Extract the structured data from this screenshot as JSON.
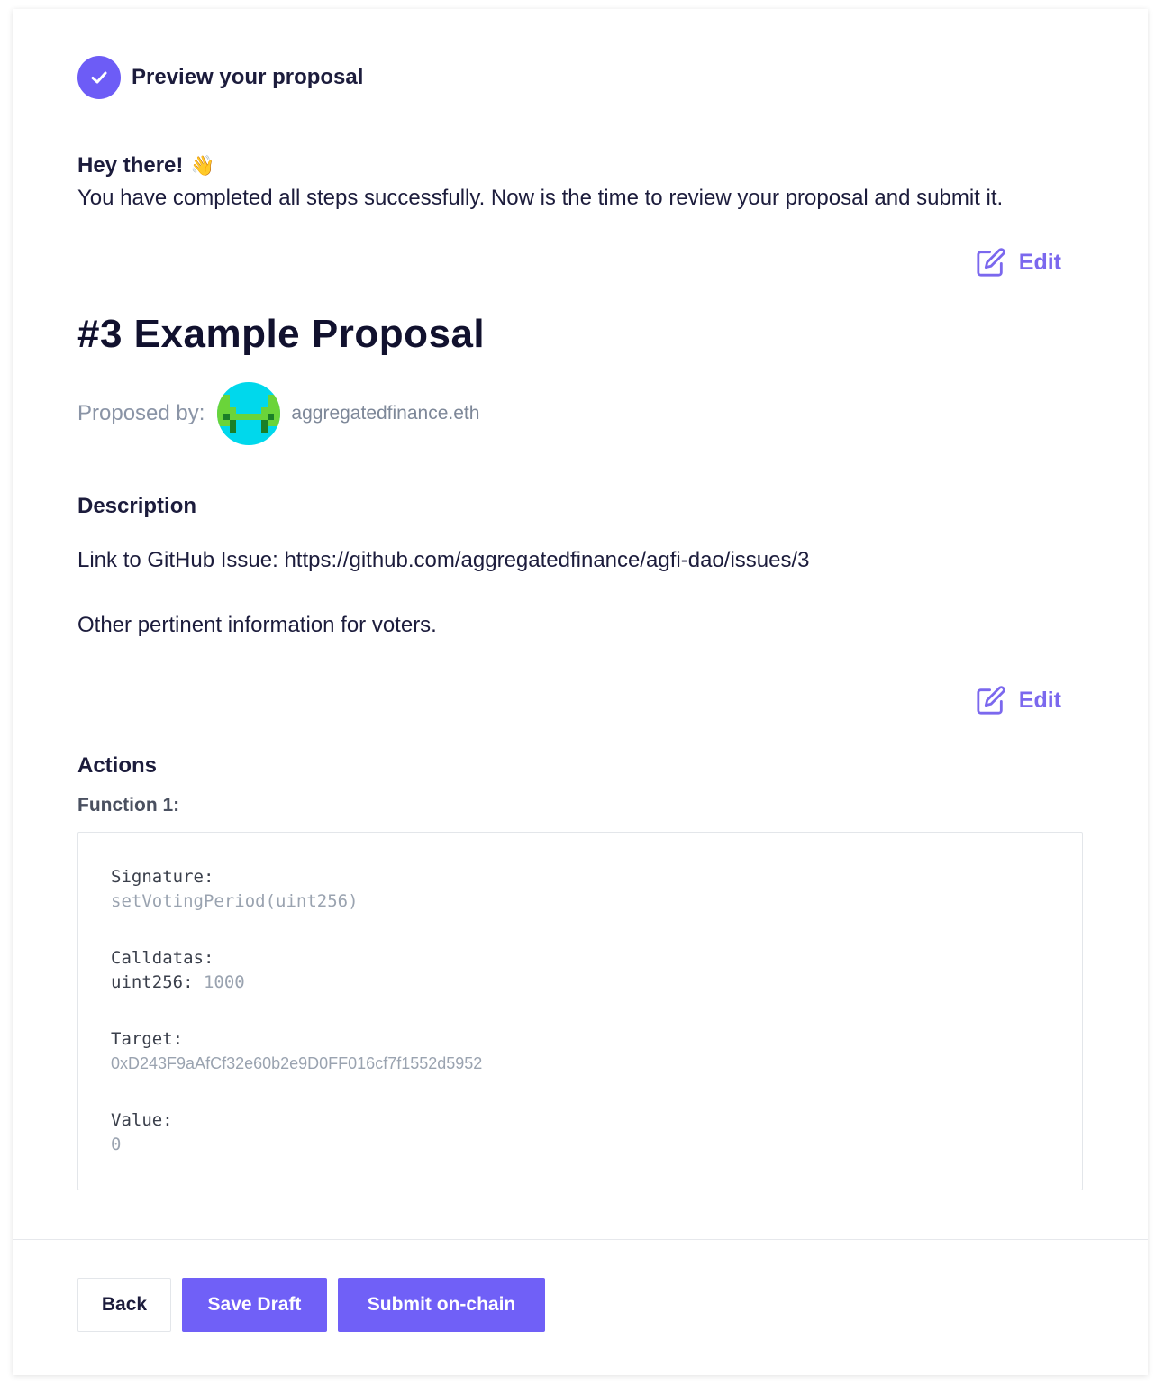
{
  "step": {
    "title": "Preview your proposal",
    "icon": "check-icon"
  },
  "greeting": {
    "title": "Hey there!",
    "emoji": "👋",
    "message": "You have completed all steps successfully. Now is the time to review your proposal and submit it."
  },
  "edit_label": "Edit",
  "proposal": {
    "title": "#3 Example Proposal",
    "proposed_by_label": "Proposed by:",
    "proposer": "aggregatedfinance.eth"
  },
  "description": {
    "label": "Description",
    "line1": "Link to GitHub Issue: https://github.com/aggregatedfinance/agfi-dao/issues/3",
    "line2": "Other pertinent information for voters."
  },
  "actions": {
    "label": "Actions",
    "function_label": "Function 1:",
    "signature_label": "Signature:",
    "signature": "setVotingPeriod(uint256)",
    "calldatas_label": "Calldatas:",
    "calldata_type": "uint256:",
    "calldata_value": "1000",
    "target_label": "Target:",
    "target": "0xD243F9aAfCf32e60b2e9D0FF016cf7f1552d5952",
    "value_label": "Value:",
    "value": "0"
  },
  "footer": {
    "back": "Back",
    "save_draft": "Save Draft",
    "submit": "Submit on-chain"
  },
  "colors": {
    "accent": "#6d5cf6",
    "button": "#7060f7",
    "muted": "#9aa3b0"
  }
}
